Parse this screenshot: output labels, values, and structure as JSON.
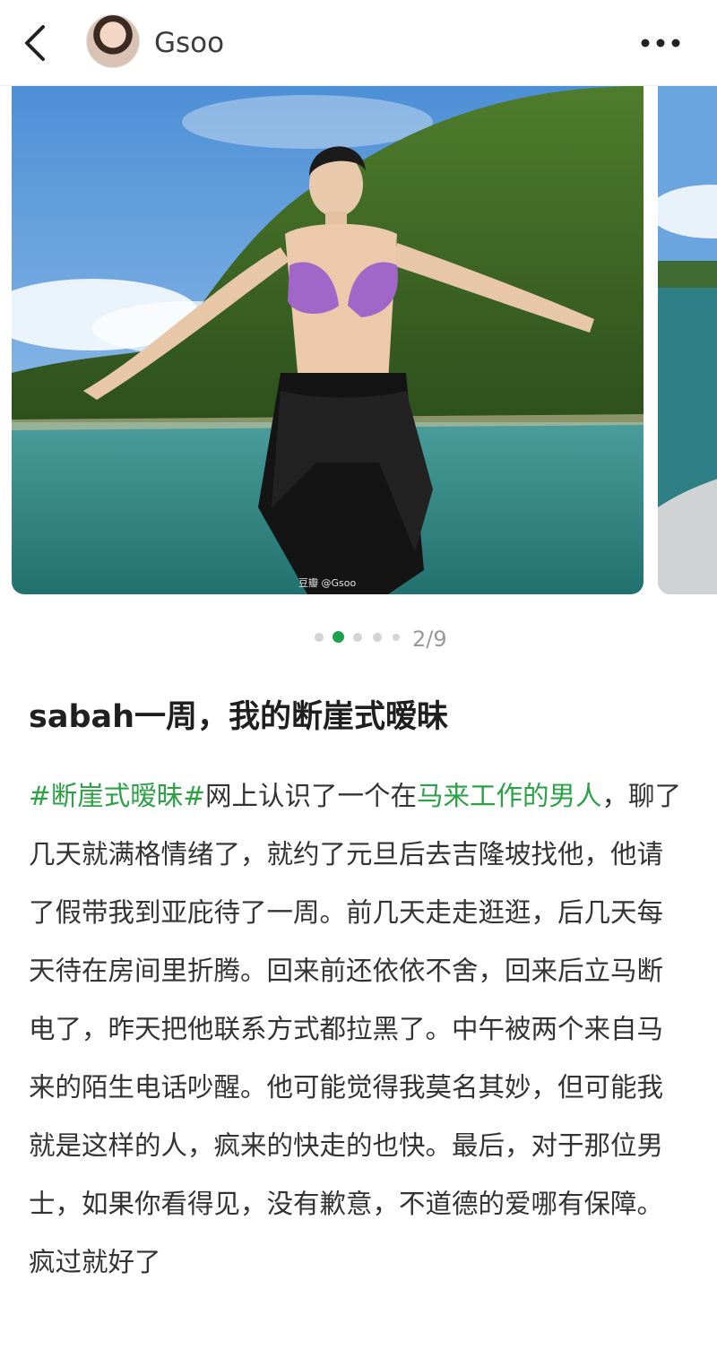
{
  "header": {
    "username": "Gsoo",
    "back_icon": "chevron-left-icon",
    "more_icon": "more-dots-icon"
  },
  "carousel": {
    "watermark": "豆瓣 @Gsoo",
    "current": 2,
    "total": 9,
    "page_indicator": "2/9"
  },
  "post": {
    "title": "sabah一周，我的断崖式暧昧",
    "hashtag": "#断崖式暧昧#",
    "body_part1": "网上认识了一个在",
    "link_text": "马来工作的男人",
    "body_part2": "，聊了几天就满格情绪了，就约了元旦后去吉隆坡找他，他请了假带我到亚庇待了一周。前几天走走逛逛，后几天每天待在房间里折腾。回来前还依依不舍，回来后立马断电了，昨天把他联系方式都拉黑了。中午被两个来自马来的陌生电话吵醒。他可能觉得我莫名其妙，但可能我就是这样的人，疯来的快走的也快。最后，对于那位男士，如果你看得见，没有歉意，不道德的爱哪有保障。疯过就好了"
  },
  "colors": {
    "accent_green": "#2ba245",
    "pager_active": "#1aa34a"
  }
}
